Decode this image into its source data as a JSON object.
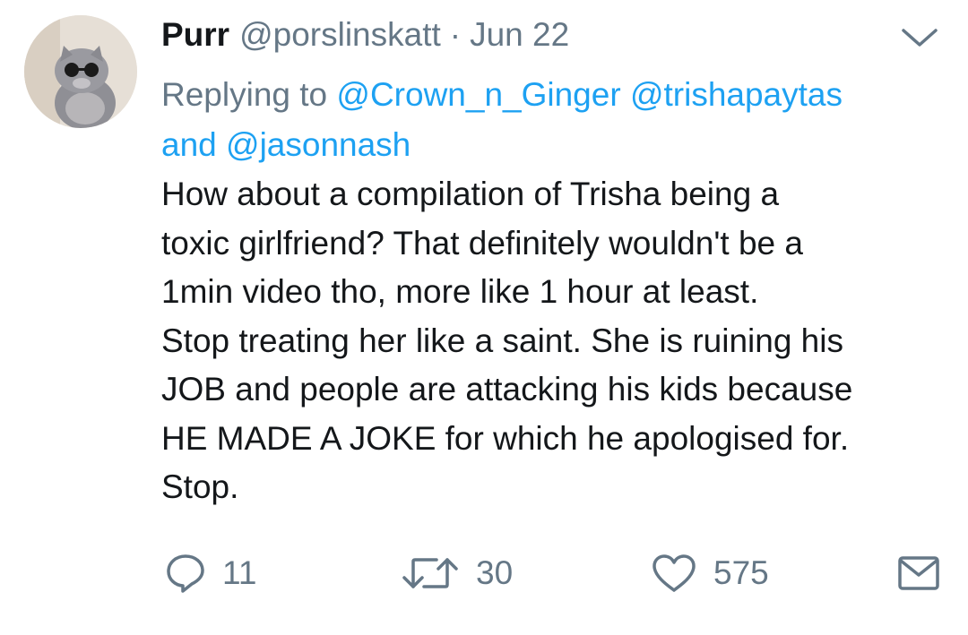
{
  "tweet": {
    "display_name": "Purr",
    "handle": "@porslinskatt",
    "separator": "·",
    "date": "Jun 22",
    "replying_prefix": "Replying to",
    "mentions": [
      "@Crown_n_Ginger",
      "@trishapaytas",
      "@jasonnash"
    ],
    "replying_and": "and",
    "body_lines": [
      "How about a compilation of Trisha being a",
      "toxic girlfriend? That definitely wouldn't be a",
      "1min video tho, more like 1 hour at least.",
      "Stop treating her like a saint. She is ruining his",
      "JOB and people are attacking his kids because",
      "HE MADE A JOKE for which he apologised for.",
      "Stop."
    ]
  },
  "actions": {
    "reply_count": "11",
    "retweet_count": "30",
    "like_count": "575"
  },
  "icons": {
    "reply": "reply-bubble-icon",
    "retweet": "retweet-arrows-icon",
    "like": "heart-icon",
    "dm": "envelope-icon",
    "caret": "chevron-down-icon"
  },
  "colors": {
    "text": "#14171a",
    "secondary": "#657786",
    "link": "#1da1f2",
    "background": "#ffffff"
  }
}
